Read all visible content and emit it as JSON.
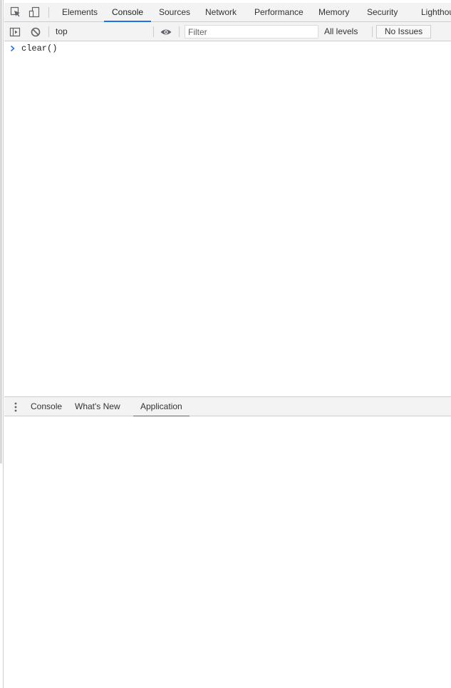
{
  "main_tabs": {
    "items": [
      {
        "label": "Elements",
        "active": false
      },
      {
        "label": "Console",
        "active": true
      },
      {
        "label": "Sources",
        "active": false
      },
      {
        "label": "Network",
        "active": false
      },
      {
        "label": "Performance",
        "active": false
      },
      {
        "label": "Memory",
        "active": false
      },
      {
        "label": "Security",
        "active": false
      },
      {
        "label": "Lighthou",
        "active": false
      }
    ],
    "icons": [
      "inspect-element-icon",
      "device-toolbar-icon"
    ]
  },
  "toolbar": {
    "context": "top",
    "filter_placeholder": "Filter",
    "levels": "All levels",
    "issues": "No Issues",
    "icons": [
      "sidebar-toggle-icon",
      "clear-console-icon",
      "live-expression-eye-icon"
    ]
  },
  "console": {
    "lines": [
      {
        "prompt": "›",
        "text": "clear()"
      }
    ]
  },
  "drawer": {
    "tabs": [
      {
        "label": "Console",
        "active": false
      },
      {
        "label": "What's New",
        "active": false
      },
      {
        "label": "Application",
        "active": true
      }
    ],
    "menu_icon": "kebab-menu-icon"
  },
  "colors": {
    "accent": "#1a73e8",
    "toolbar_bg": "#f3f3f3",
    "border": "#cbcdd1",
    "prompt": "#1a73e8"
  }
}
